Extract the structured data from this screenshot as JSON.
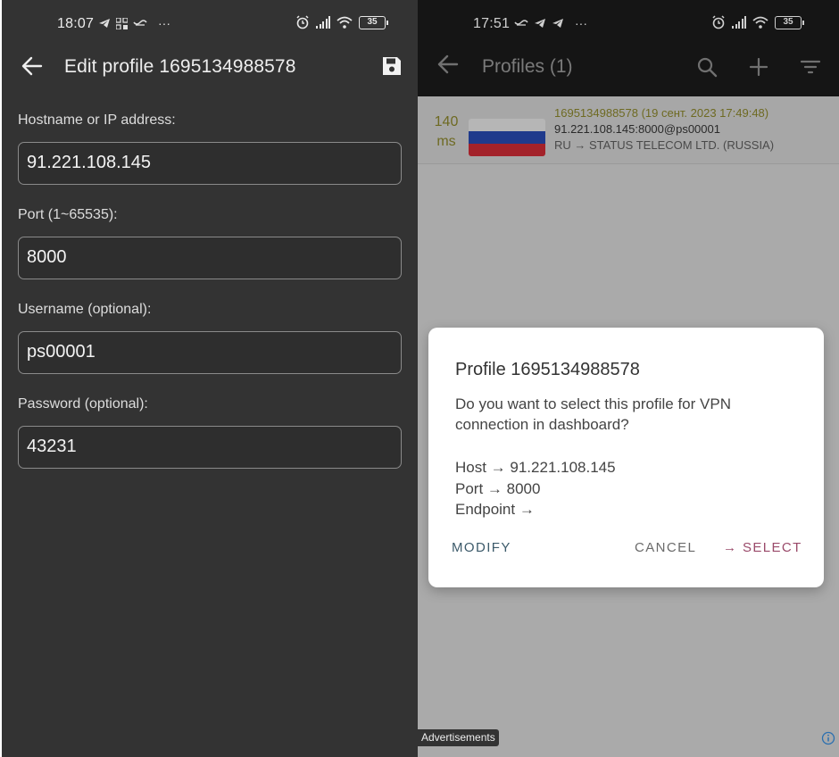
{
  "left": {
    "status": {
      "time": "18:07",
      "extra": "···",
      "battery": "35"
    },
    "title": "Edit profile 1695134988578",
    "icons": {
      "back": "back-arrow-icon",
      "save": "save-icon"
    },
    "fields": [
      {
        "label": "Hostname or IP address:",
        "value": "91.221.108.145"
      },
      {
        "label": "Port (1~65535):",
        "value": "8000"
      },
      {
        "label": "Username (optional):",
        "value": "ps00001"
      },
      {
        "label": "Password (optional):",
        "value": "43231"
      }
    ]
  },
  "right": {
    "status": {
      "time": "17:51",
      "extra": "···",
      "battery": "35"
    },
    "title": "Profiles (1)",
    "icons": {
      "back": "back-arrow-icon",
      "search": "search-icon",
      "add": "plus-icon",
      "filter": "filter-icon"
    },
    "profile": {
      "ping_value": "140",
      "ping_unit": "ms",
      "line1": "1695134988578 (19 сент. 2023 17:49:48)",
      "line2": "91.221.108.145:8000@ps00001",
      "line3": "RU → STATUS TELECOM LTD. (RUSSIA)"
    },
    "dialog": {
      "title": "Profile 1695134988578",
      "message": "Do you want to select this profile for VPN connection in dashboard?",
      "host": "Host → 91.221.108.145",
      "port": "Port → 8000",
      "endpoint": "Endpoint →",
      "modify": "MODIFY",
      "cancel": "CANCEL",
      "select": "→ SELECT"
    },
    "ad_label": "Advertisements"
  },
  "colors": {
    "left_bg": "#333333",
    "right_toolbar": "#151515",
    "ping_color": "#6e6a22",
    "select_color": "#9a4a6a",
    "modify_color": "#3c5a6a"
  }
}
